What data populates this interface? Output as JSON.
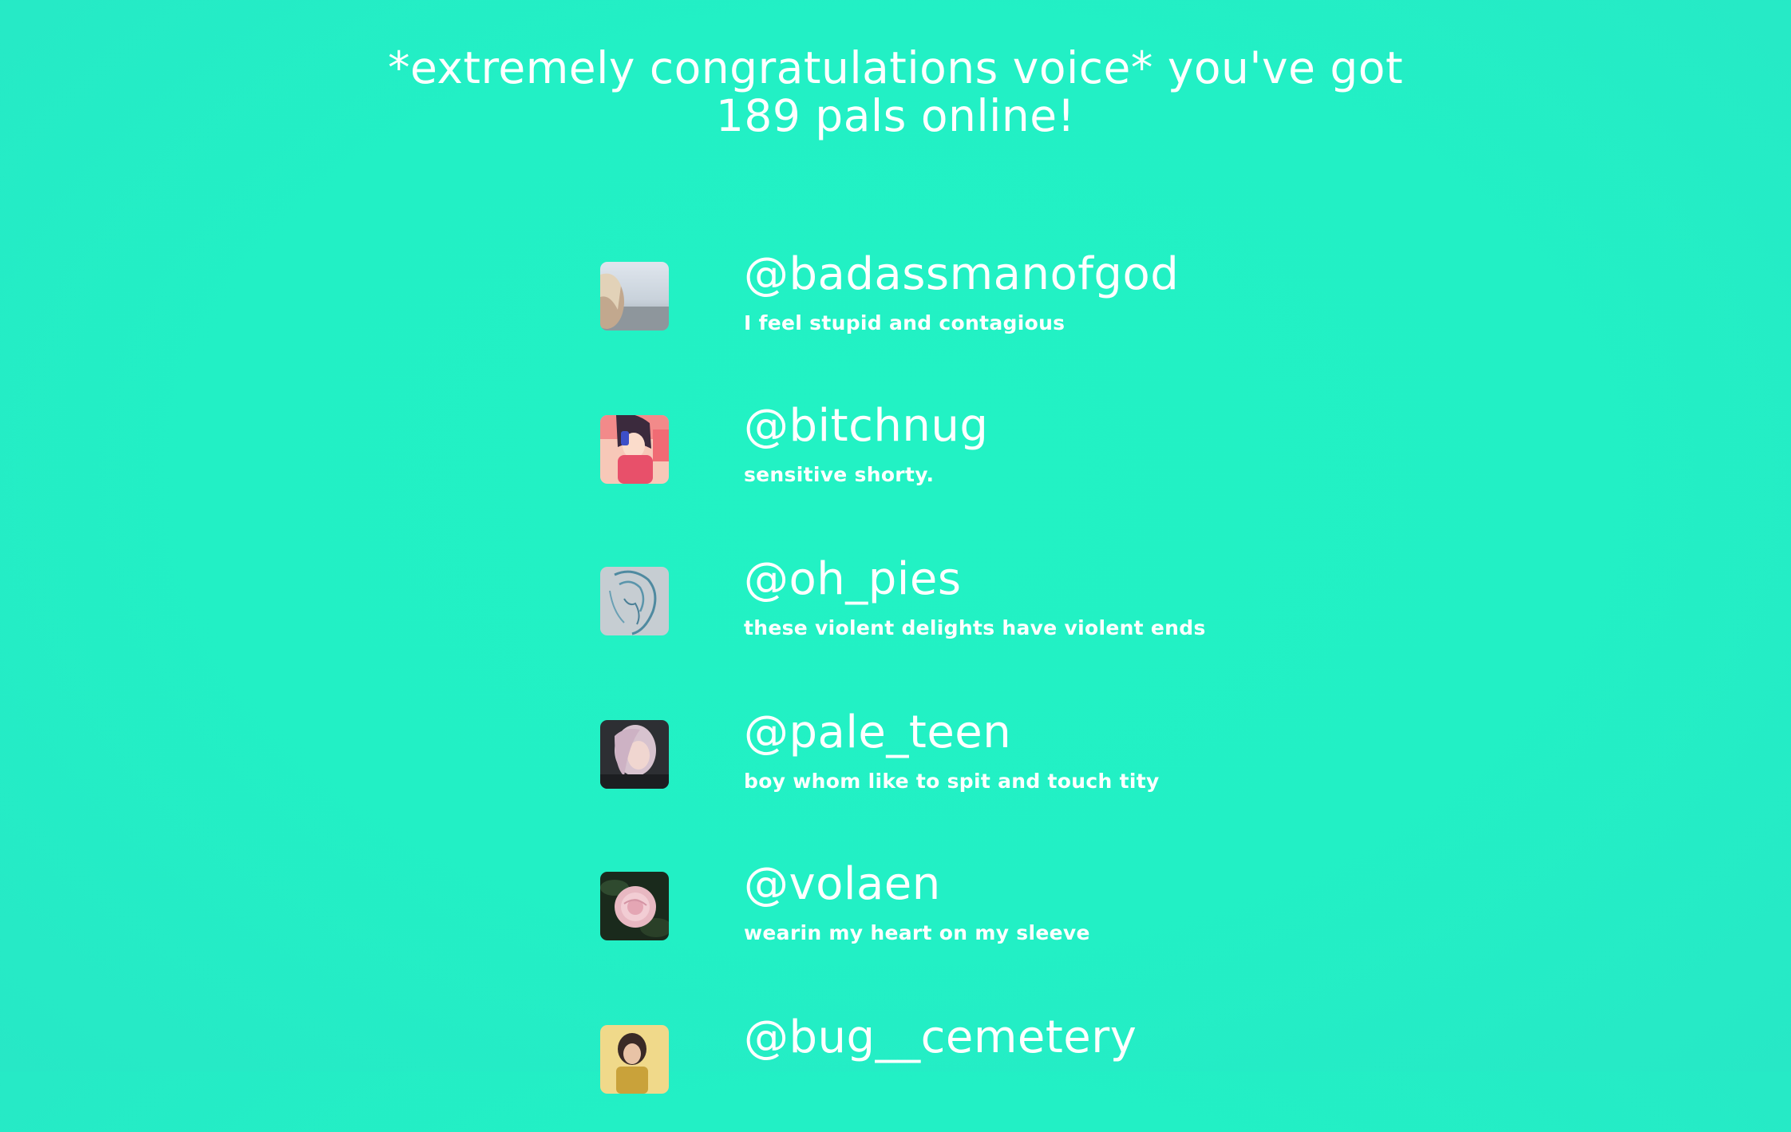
{
  "headline": {
    "line1": "*extremely congratulations voice* you've got",
    "line2": "189 pals online!"
  },
  "pals": [
    {
      "handle": "@badassmanofgod",
      "bio": "I feel stupid and contagious",
      "avatar_icon": "avatar-photo-beach-icon"
    },
    {
      "handle": "@bitchnug",
      "bio": "sensitive shorty.",
      "avatar_icon": "avatar-anime-girl-icon"
    },
    {
      "handle": "@oh_pies",
      "bio": "these violent delights have violent ends",
      "avatar_icon": "avatar-sketch-icon"
    },
    {
      "handle": "@pale_teen",
      "bio": "boy whom like to spit and touch tity",
      "avatar_icon": "avatar-selfie-icon"
    },
    {
      "handle": "@volaen",
      "bio": "wearin my heart on my sleeve",
      "avatar_icon": "avatar-rose-icon"
    },
    {
      "handle": "@bug__cemetery",
      "bio": "",
      "avatar_icon": "avatar-portrait-icon"
    }
  ]
}
